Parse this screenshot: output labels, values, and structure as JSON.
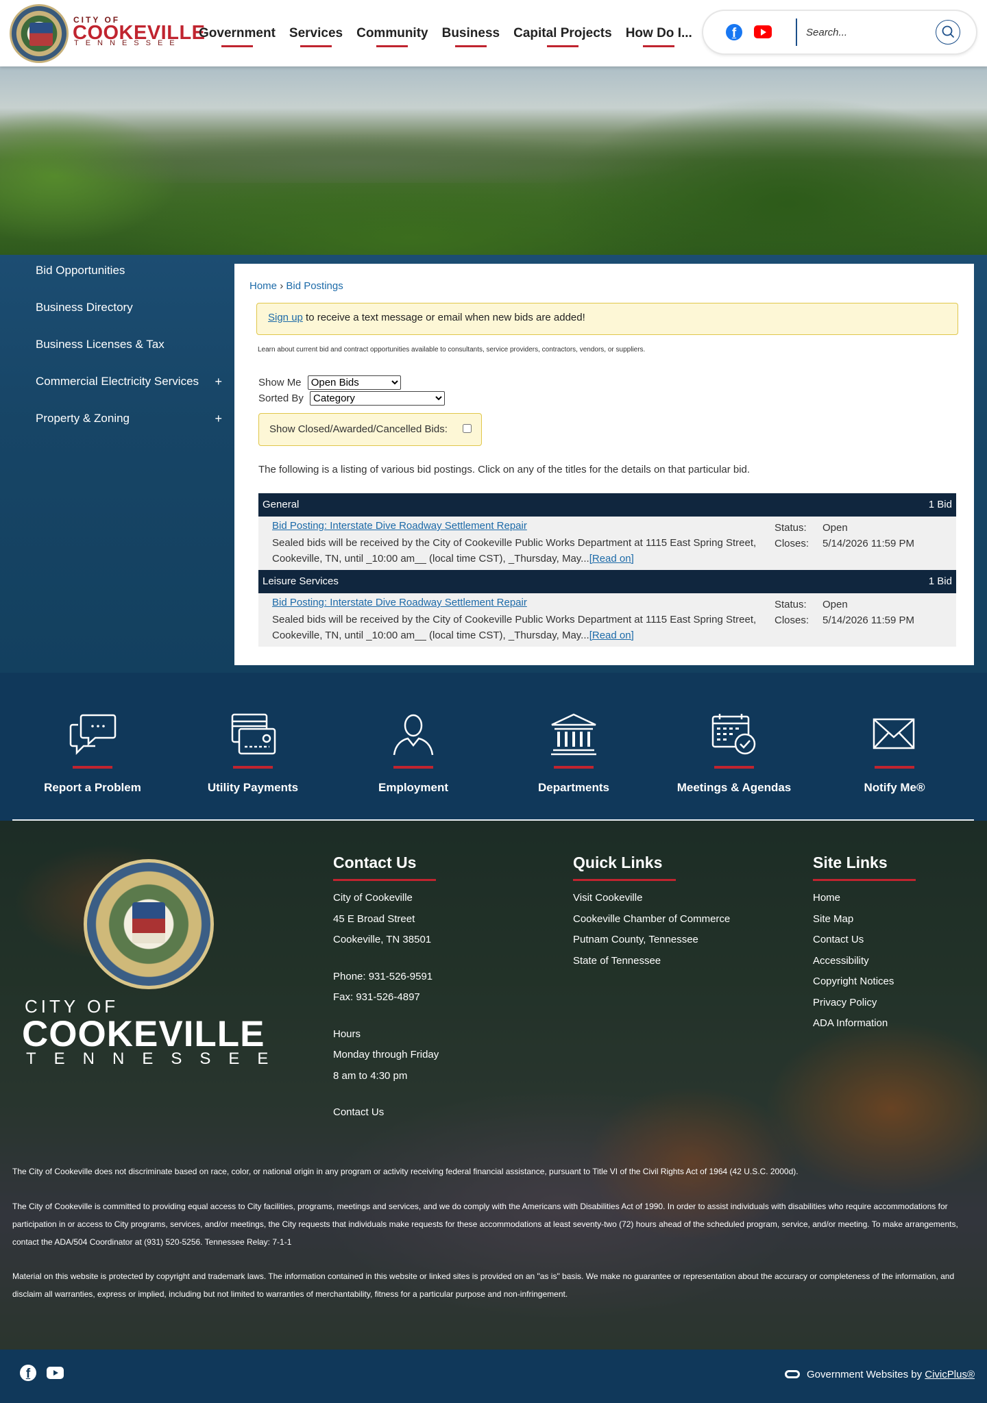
{
  "header": {
    "logo": {
      "city_of": "CITY OF",
      "name": "COOKEVILLE",
      "state": "TENNESSEE"
    },
    "nav": [
      "Government",
      "Services",
      "Community",
      "Business",
      "Capital Projects",
      "How Do I..."
    ],
    "social": {
      "facebook": "facebook-icon",
      "youtube": "youtube-icon"
    },
    "search": {
      "placeholder": "Search..."
    }
  },
  "sidebar": {
    "items": [
      {
        "label": "Bid Opportunities",
        "expand": ""
      },
      {
        "label": "Business Directory",
        "expand": ""
      },
      {
        "label": "Business Licenses & Tax",
        "expand": ""
      },
      {
        "label": "Commercial Electricity Services",
        "expand": "+"
      },
      {
        "label": "Property & Zoning",
        "expand": "+"
      }
    ]
  },
  "content": {
    "breadcrumb": {
      "home": "Home",
      "sep": "›",
      "current": "Bid Postings"
    },
    "notice": {
      "link": "Sign up",
      "text": " to receive a text message or email when new bids are added!"
    },
    "intro": "Learn about current bid and contract opportunities available to consultants, service providers, contractors, vendors, or suppliers.",
    "filters": {
      "show_me_label": "Show Me",
      "show_me_value": "Open Bids",
      "sorted_by_label": "Sorted By",
      "sorted_by_value": "Category",
      "closed_label": "Show Closed/Awarded/Cancelled Bids:"
    },
    "listing_desc": "The following is a listing of various bid postings. Click on any of the titles for the details on that particular bid.",
    "categories": [
      {
        "name": "General",
        "count": "1 Bid",
        "bid": {
          "title": "Bid Posting: Interstate Dive Roadway Settlement Repair",
          "description": "Sealed bids will be received by the City of Cookeville Public Works Department at 1115 East Spring Street, Cookeville, TN, until _10:00 am__ (local time CST), _Thursday, May...",
          "read_on": "[Read on]",
          "status_label": "Status:",
          "status": "Open",
          "closes_label": "Closes:",
          "closes": "5/14/2026 11:59 PM"
        }
      },
      {
        "name": "Leisure Services",
        "count": "1 Bid",
        "bid": {
          "title": "Bid Posting: Interstate Dive Roadway Settlement Repair",
          "description": "Sealed bids will be received by the City of Cookeville Public Works Department at 1115 East Spring Street, Cookeville, TN, until _10:00 am__ (local time CST), _Thursday, May...",
          "read_on": "[Read on]",
          "status_label": "Status:",
          "status": "Open",
          "closes_label": "Closes:",
          "closes": "5/14/2026 11:59 PM"
        }
      }
    ]
  },
  "quick_links": [
    {
      "label": "Report a Problem",
      "icon": "chat-bubbles-icon"
    },
    {
      "label": "Utility Payments",
      "icon": "payment-card-icon"
    },
    {
      "label": "Employment",
      "icon": "person-icon"
    },
    {
      "label": "Departments",
      "icon": "building-columns-icon"
    },
    {
      "label": "Meetings & Agendas",
      "icon": "calendar-check-icon"
    },
    {
      "label": "Notify Me®",
      "icon": "envelope-icon"
    }
  ],
  "footer": {
    "logo": {
      "city_of": "CITY OF",
      "name": "COOKEVILLE",
      "state": "TENNESSEE"
    },
    "contact": {
      "heading": "Contact Us",
      "name": "City of Cookeville",
      "street": "45 E Broad Street",
      "city": "Cookeville, TN 38501",
      "phone": "Phone: 931-526-9591",
      "fax": "Fax: 931-526-4897",
      "hours_label": "Hours",
      "days": "Monday through Friday",
      "time": "8 am to 4:30 pm",
      "link": "Contact Us"
    },
    "quick_links": {
      "heading": "Quick Links",
      "items": [
        "Visit Cookeville",
        "Cookeville Chamber of Commerce",
        "Putnam County, Tennessee",
        "State of Tennessee"
      ]
    },
    "site_links": {
      "heading": "Site Links",
      "items": [
        "Home",
        "Site Map",
        "Contact Us",
        "Accessibility",
        "Copyright Notices",
        "Privacy Policy",
        "ADA Information"
      ]
    },
    "disclaimers": [
      "The City of Cookeville does not discriminate based on race, color, or national origin in any program or activity receiving federal financial assistance, pursuant to Title VI of the Civil Rights Act of 1964 (42 U.S.C. 2000d).",
      "The City of Cookeville is committed to providing equal access to City facilities, programs, meetings and services, and we do comply with the Americans with Disabilities Act of 1990. In order to assist individuals with disabilities who require accommodations for participation in or access to City programs, services, and/or meetings, the City requests that individuals make requests for these accommodations at least seventy-two (72) hours ahead of the scheduled program, service, and/or meeting. To make arrangements, contact the ADA/504 Coordinator at (931) 520-5256. Tennessee Relay: 7-1-1",
      "Material on this website is protected by copyright and trademark laws. The information contained in this website or linked sites is provided on an \"as is\" basis. We make no guarantee or representation about the accuracy or completeness of the information, and disclaim all warranties, express or implied, including but not limited to warranties of merchantability, fitness for a particular purpose and non-infringement."
    ]
  },
  "bottom_bar": {
    "prefix": "Government Websites by ",
    "link": "CivicPlus®"
  },
  "colors": {
    "brand_red": "#c0242f",
    "navy": "#10385a",
    "link_blue": "#1c6aa8",
    "notice_yellow": "#fdf7d6"
  }
}
